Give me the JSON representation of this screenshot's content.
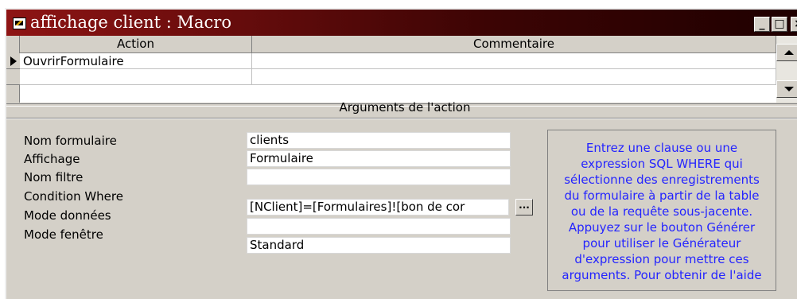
{
  "window": {
    "title": "affichage client : Macro",
    "controls": {
      "minimize": "_",
      "maximize": "□",
      "close": "×"
    }
  },
  "grid": {
    "columns": [
      "Action",
      "Commentaire"
    ],
    "rows": [
      {
        "action": "OuvrirFormulaire",
        "comment": ""
      },
      {
        "action": "",
        "comment": ""
      }
    ]
  },
  "arguments": {
    "section_title": "Arguments de l'action",
    "fields": [
      {
        "label": "Nom formulaire",
        "value": "clients"
      },
      {
        "label": "Affichage",
        "value": "Formulaire"
      },
      {
        "label": "Nom filtre",
        "value": ""
      },
      {
        "label": "Condition Where",
        "value": "[NClient]=[Formulaires]![bon de cor"
      },
      {
        "label": "Mode données",
        "value": ""
      },
      {
        "label": "Mode fenêtre",
        "value": "Standard"
      }
    ],
    "builder_button": "...",
    "help_text": "Entrez une clause ou une expression SQL WHERE qui sélectionne des enregistrements du formulaire à partir de la table ou de la requête sous-jacente. Appuyez sur le bouton Générer pour utiliser le Générateur d'expression pour mettre ces arguments. Pour obtenir de l'aide",
    "help_color": "#2424ff"
  },
  "colors": {
    "title_gradient_start": "#8e1414",
    "title_gradient_end": "#1e0000",
    "window_background": "#d4d0c8"
  },
  "icons": {
    "app": "macro-icon",
    "row_selector": "arrow-right-icon",
    "scroll_up": "scroll-up-icon",
    "scroll_down": "scroll-down-icon"
  }
}
